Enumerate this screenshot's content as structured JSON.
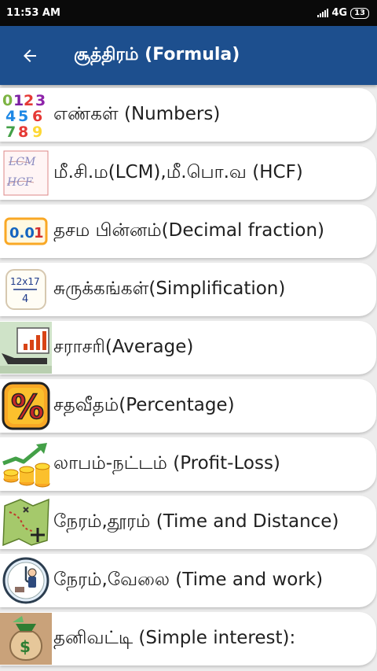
{
  "status_bar": {
    "time": "11:53 AM",
    "network": "4G",
    "battery": "13"
  },
  "app_bar": {
    "title": "சூத்திரம் (Formula)",
    "back_icon": "arrow-left-icon"
  },
  "items": [
    {
      "label": "எண்கள் (Numbers)",
      "icon": "numbers-icon"
    },
    {
      "label": "மீ.சி.ம(LCM),மீ.பொ.வ (HCF)",
      "icon": "lcm-hcf-icon"
    },
    {
      "label": "தசம பின்னம்(Decimal fraction)",
      "icon": "decimal-icon"
    },
    {
      "label": "சுருக்கங்கள்(Simplification)",
      "icon": "simplification-icon"
    },
    {
      "label": "சராசரி(Average)",
      "icon": "average-chart-icon"
    },
    {
      "label": "சதவீதம்(Percentage)",
      "icon": "percentage-icon"
    },
    {
      "label": "லாபம்-நட்டம் (Profit-Loss)",
      "icon": "profit-loss-icon"
    },
    {
      "label": "நேரம்,தூரம் (Time and Distance)",
      "icon": "map-distance-icon"
    },
    {
      "label": "நேரம்,வேலை (Time and work)",
      "icon": "clock-work-icon"
    },
    {
      "label": "தனிவட்டி (Simple interest):",
      "icon": "money-bag-icon"
    }
  ]
}
